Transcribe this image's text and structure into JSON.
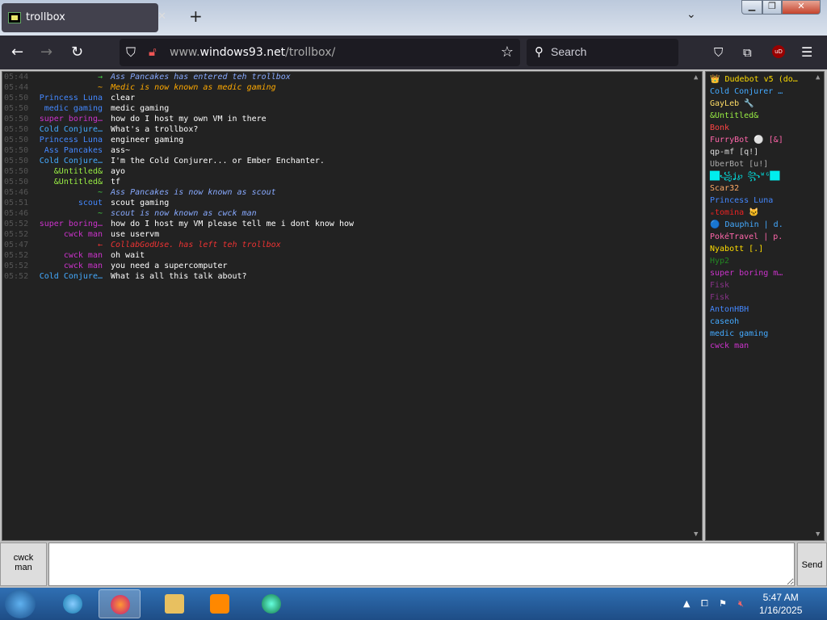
{
  "browser": {
    "tab_title": "trollbox",
    "url_host": "www.",
    "url_domain": "windows93.net",
    "url_path": "/trollbox/",
    "search_placeholder": "Search"
  },
  "chat": {
    "messages": [
      {
        "time": "05:44",
        "nick": "→",
        "text": "Ass Pancakes has entered teh trollbox",
        "nick_color": "#4c4",
        "text_color": "#8af",
        "system": true
      },
      {
        "time": "05:44",
        "nick": "~",
        "text": "Medic is now known as medic gaming",
        "nick_color": "#fa0",
        "text_color": "#fa0",
        "system": true
      },
      {
        "time": "05:50",
        "nick": "Princess Luna",
        "text": "clear",
        "nick_color": "#48f",
        "text_color": "#fff"
      },
      {
        "time": "05:50",
        "nick": "medic gaming",
        "text": "medic gaming",
        "nick_color": "#48f",
        "text_color": "#fff"
      },
      {
        "time": "05:50",
        "nick": "super boring…",
        "text": "how do I host my own VM in there",
        "nick_color": "#c3c",
        "text_color": "#fff"
      },
      {
        "time": "05:50",
        "nick": "Cold Conjure…",
        "text": "What's a trollbox?",
        "nick_color": "#4af",
        "text_color": "#fff"
      },
      {
        "time": "05:50",
        "nick": "Princess Luna",
        "text": "engineer gaming",
        "nick_color": "#48f",
        "text_color": "#fff"
      },
      {
        "time": "05:50",
        "nick": "Ass Pancakes",
        "text": "ass~",
        "nick_color": "#48f",
        "text_color": "#fff"
      },
      {
        "time": "05:50",
        "nick": "Cold Conjure…",
        "text": "I'm the Cold Conjurer... or Ember Enchanter.",
        "nick_color": "#4af",
        "text_color": "#fff"
      },
      {
        "time": "05:50",
        "nick": "&Untitled&",
        "text": "ayo",
        "nick_color": "#9e4",
        "text_color": "#fff"
      },
      {
        "time": "05:50",
        "nick": "&Untitled&",
        "text": "tf",
        "nick_color": "#9e4",
        "text_color": "#fff"
      },
      {
        "time": "05:46",
        "nick": "~",
        "text": "Ass Pancakes is now known as scout",
        "nick_color": "#4c4",
        "text_color": "#8af",
        "system": true
      },
      {
        "time": "05:51",
        "nick": "scout",
        "text": "scout gaming",
        "nick_color": "#48f",
        "text_color": "#fff"
      },
      {
        "time": "05:46",
        "nick": "~",
        "text": "scout is now known as cwck man",
        "nick_color": "#4c4",
        "text_color": "#8af",
        "system": true
      },
      {
        "time": "05:52",
        "nick": "super boring…",
        "text": "how do I host my VM please tell me i dont know how",
        "nick_color": "#c3c",
        "text_color": "#fff"
      },
      {
        "time": "05:52",
        "nick": "cwck man",
        "text": "use uservm",
        "nick_color": "#c3c",
        "text_color": "#fff"
      },
      {
        "time": "05:47",
        "nick": "←",
        "text": "CollabGodUse. has left teh trollbox",
        "nick_color": "#e33",
        "text_color": "#e33",
        "system": true
      },
      {
        "time": "05:52",
        "nick": "cwck man",
        "text": "oh wait",
        "nick_color": "#c3c",
        "text_color": "#fff"
      },
      {
        "time": "05:52",
        "nick": "cwck man",
        "text": "you need a supercomputer",
        "nick_color": "#c3c",
        "text_color": "#fff"
      },
      {
        "time": "05:52",
        "nick": "Cold Conjure…",
        "text": "What is all this talk about?",
        "nick_color": "#4af",
        "text_color": "#fff"
      }
    ]
  },
  "users": [
    {
      "name": "👑 Dudebot v5 (do…",
      "color": "#fd0"
    },
    {
      "name": "Cold Conjurer …",
      "color": "#4af"
    },
    {
      "name": "GayLeb 🔧",
      "color": "#fd6"
    },
    {
      "name": "&Untitled&",
      "color": "#9e4"
    },
    {
      "name": "Bonk",
      "color": "#f44"
    },
    {
      "name": "FurryBot ⚪ [&]",
      "color": "#f6a"
    },
    {
      "name": "qp-mf [q!]",
      "color": "#ddd"
    },
    {
      "name": "UberBot [u!]",
      "color": "#aaa"
    },
    {
      "name": "██꧁ʝ℘ ꧂ᵂᴳ██",
      "color": "#0ee"
    },
    {
      "name": "Scar32",
      "color": "#fa6"
    },
    {
      "name": "Princess Luna",
      "color": "#48f"
    },
    {
      "name": "ₑtomina 🐱",
      "color": "#e22"
    },
    {
      "name": "🔵 Dauphin | d.",
      "color": "#4af"
    },
    {
      "name": "PokéTravel | p.",
      "color": "#f6a"
    },
    {
      "name": "Nyabott [.]",
      "color": "#fd0"
    },
    {
      "name": "Hyp2",
      "color": "#282"
    },
    {
      "name": "super boring m…",
      "color": "#c3c"
    },
    {
      "name": "Fisk",
      "color": "#838"
    },
    {
      "name": "Fisk",
      "color": "#838"
    },
    {
      "name": "AntonHBH",
      "color": "#48f"
    },
    {
      "name": "caseoh",
      "color": "#4af"
    },
    {
      "name": "medic gaming",
      "color": "#4af"
    },
    {
      "name": "cwck man",
      "color": "#c3c"
    }
  ],
  "composer": {
    "nick_line1": "cwck",
    "nick_line2": "man",
    "send_label": "Send"
  },
  "taskbar": {
    "time": "5:47 AM",
    "date": "1/16/2025"
  }
}
